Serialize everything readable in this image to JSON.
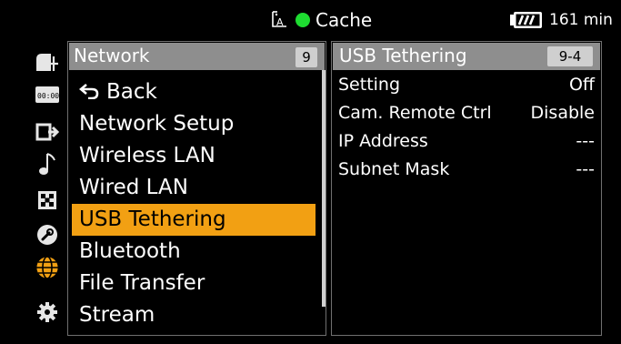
{
  "status": {
    "cache_text": "Cache",
    "battery_time": "161 min",
    "colors": {
      "cache_dot": "#1edc31",
      "accent": "#f2a013"
    }
  },
  "sidebar": {
    "icons": [
      "camera-settings-icon",
      "timecode-icon",
      "output-icon",
      "audio-note-icon",
      "checker-icon",
      "wrench-icon",
      "network-globe-icon",
      "gear-icon"
    ],
    "active_index": 6
  },
  "left_menu": {
    "header": {
      "title": "Network",
      "badge": "9"
    },
    "items": [
      {
        "label": "Back"
      },
      {
        "label": "Network Setup"
      },
      {
        "label": "Wireless LAN"
      },
      {
        "label": "Wired LAN"
      },
      {
        "label": "USB Tethering"
      },
      {
        "label": "Bluetooth"
      },
      {
        "label": "File Transfer"
      },
      {
        "label": "Stream"
      }
    ],
    "selected_index": 4
  },
  "right_panel": {
    "header": {
      "title": "USB Tethering",
      "badge": "9-4"
    },
    "rows": [
      {
        "label": "Setting",
        "value": "Off"
      },
      {
        "label": "Cam. Remote Ctrl",
        "value": "Disable"
      },
      {
        "label": "IP Address",
        "value": "---"
      },
      {
        "label": "Subnet Mask",
        "value": "---"
      }
    ]
  }
}
